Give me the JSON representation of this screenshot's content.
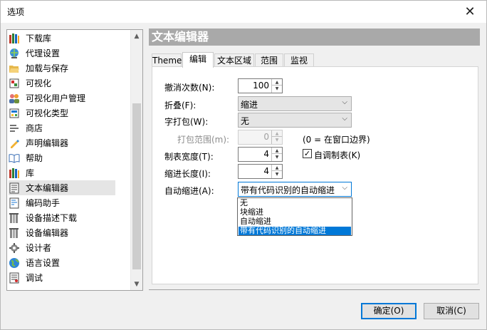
{
  "window": {
    "title": "选项",
    "close_glyph": "✕"
  },
  "tree": {
    "items": [
      {
        "label": "下载库",
        "icon": "books-icon"
      },
      {
        "label": "代理设置",
        "icon": "globe-user-icon"
      },
      {
        "label": "加载与保存",
        "icon": "open-folder-icon"
      },
      {
        "label": "可视化",
        "icon": "visualize-icon"
      },
      {
        "label": "可视化用户管理",
        "icon": "users-icon"
      },
      {
        "label": "可视化类型",
        "icon": "types-icon"
      },
      {
        "label": "商店",
        "icon": "store-list-icon"
      },
      {
        "label": "声明编辑器",
        "icon": "declaration-icon"
      },
      {
        "label": "帮助",
        "icon": "help-book-icon"
      },
      {
        "label": "库",
        "icon": "library-icon"
      },
      {
        "label": "文本编辑器",
        "icon": "text-document-icon"
      },
      {
        "label": "编码助手",
        "icon": "coding-assistant-icon"
      },
      {
        "label": "设备描述下载",
        "icon": "device-download-icon"
      },
      {
        "label": "设备编辑器",
        "icon": "device-editor-icon"
      },
      {
        "label": "设计者",
        "icon": "designer-icon"
      },
      {
        "label": "语言设置",
        "icon": "language-globe-icon"
      },
      {
        "label": "调试",
        "icon": "debug-icon"
      }
    ],
    "selected_index": 10
  },
  "panel": {
    "title": "文本编辑器",
    "tabs": [
      "Theme",
      "编辑",
      "文本区域",
      "范围",
      "监视"
    ],
    "active_tab": 1,
    "fields": {
      "undo_label": "撤消次数(N):",
      "undo_value": "100",
      "fold_label": "折叠(F):",
      "fold_value": "缩进",
      "wrap_label": "字打包(W):",
      "wrap_value": "无",
      "wrap_range_label": "打包范围(m):",
      "wrap_range_value": "0",
      "wrap_range_hint": "(0 = 在窗口边界)",
      "tab_width_label": "制表宽度(T):",
      "tab_width_value": "4",
      "auto_tab_label": "自调制表(K)",
      "auto_tab_checked": true,
      "indent_len_label": "缩进长度(I):",
      "indent_len_value": "4",
      "auto_indent_label": "自动缩进(A):",
      "auto_indent_value": "带有代码识别的自动缩进"
    },
    "dropdown_options": [
      "无",
      "块缩进",
      "自动缩进",
      "带有代码识别的自动缩进"
    ],
    "dropdown_selected": 3
  },
  "buttons": {
    "ok": "确定(O)",
    "cancel": "取消(C)"
  }
}
